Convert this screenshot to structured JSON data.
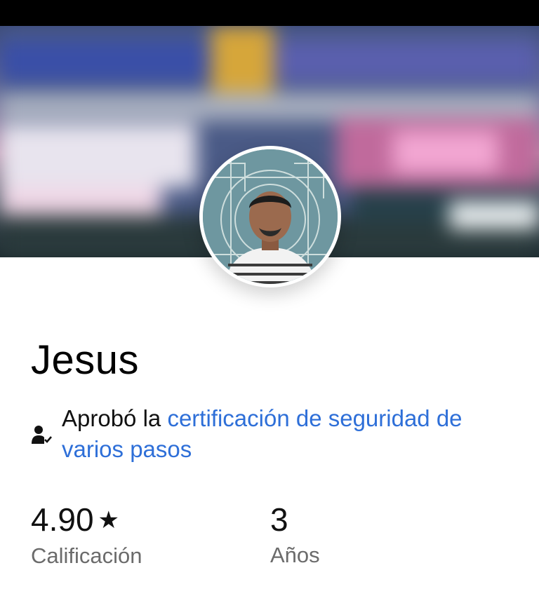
{
  "profile": {
    "name": "Jesus",
    "cert_prefix": "Aprobó la ",
    "cert_link": "certificación de seguridad de varios pasos"
  },
  "stats": {
    "rating": {
      "value": "4.90",
      "star": "★",
      "label": "Calificación"
    },
    "years": {
      "value": "3",
      "label": "Años"
    }
  },
  "icons": {
    "certification": "person-check-icon",
    "star": "star-icon"
  },
  "colors": {
    "link": "#2e6fd8",
    "label": "#6b6b6b",
    "status_bar": "#000000"
  }
}
